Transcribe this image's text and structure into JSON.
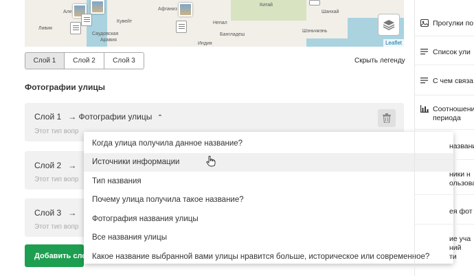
{
  "map": {
    "labels": [
      "Але",
      "Ливия",
      "Саудовская",
      "Аравия",
      "Кувейт",
      "Афганиз",
      "Непал",
      "Бангладеш",
      "Индия",
      "Шанхай",
      "Шэньчжэнь",
      "Китай"
    ],
    "attribution": "Leaflet"
  },
  "tabs": [
    {
      "label": "Слой 1",
      "active": true
    },
    {
      "label": "Слой 2",
      "active": false
    },
    {
      "label": "Слой 3",
      "active": false
    }
  ],
  "hide_legend": "Скрыть легенду",
  "section_title": "Фотографии улицы",
  "layers": [
    {
      "label": "Слой 1",
      "arrow_text": "→ Фотографии улицы",
      "chevron": "⌃",
      "desc": "Этот тип вопр"
    },
    {
      "label": "Слой 2",
      "arrow_text": "→",
      "desc": "Этот тип вопр"
    },
    {
      "label": "Слой 3",
      "arrow_text": "→",
      "desc": "Этот тип вопр"
    }
  ],
  "add_button": "Добавить сло",
  "dropdown": {
    "items": [
      "Когда улица получила данное название?",
      "Источники информации",
      "Тип названия",
      "Почему улица получила такое название?",
      "Фотография названия улицы",
      "Все названия улицы",
      "Какое название выбранной вами улицы нравится больше, историческое или современное?"
    ],
    "hover_index": 1
  },
  "sidebar": {
    "items": [
      {
        "icon": "photo-icon",
        "lines": [
          "Прогулки по"
        ]
      },
      {
        "icon": "list-icon",
        "lines": [
          "Список ули"
        ]
      },
      {
        "icon": "list-icon",
        "lines": [
          "С чем связа"
        ]
      },
      {
        "icon": "bar-chart-icon",
        "lines": [
          "Соотношени",
          "периода"
        ]
      },
      {
        "icon": "",
        "lines": [
          "названи"
        ]
      },
      {
        "icon": "",
        "lines": [
          "ники н",
          "ользовал"
        ]
      },
      {
        "icon": "",
        "lines": [
          "ея фот"
        ]
      },
      {
        "icon": "",
        "lines": [
          "ие уча",
          "ний ",
          "ти"
        ]
      }
    ]
  }
}
